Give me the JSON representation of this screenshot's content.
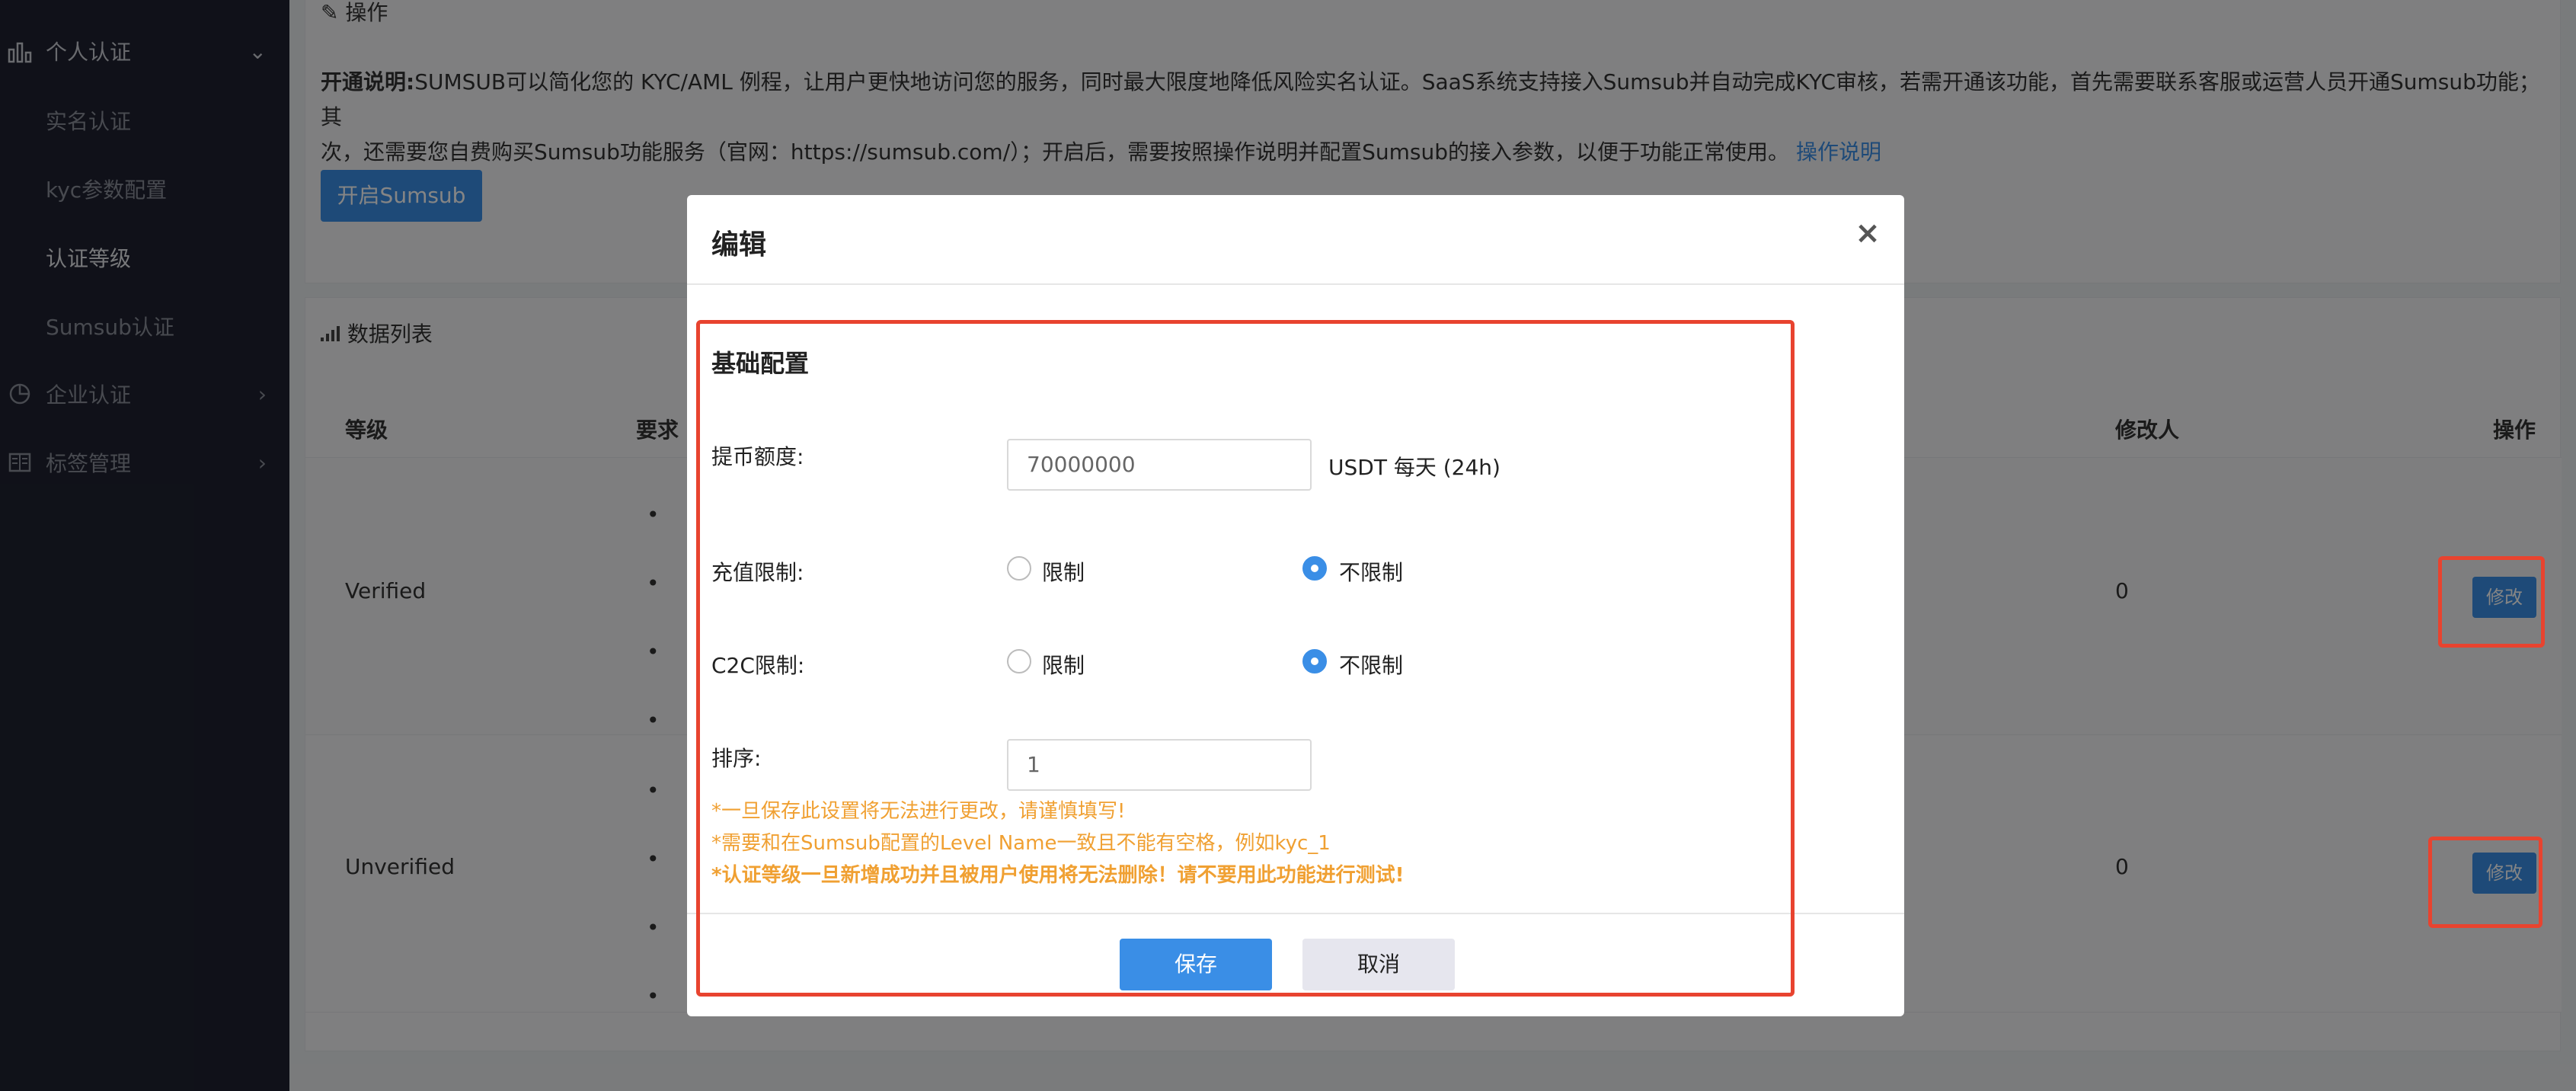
{
  "sidebar": {
    "group_personal": "个人认证",
    "sub_items": [
      "实名认证",
      "kyc参数配置",
      "认证等级",
      "Sumsub认证"
    ],
    "group_enterprise": "企业认证",
    "group_tags": "标签管理"
  },
  "ops_panel": {
    "header": "操作",
    "desc_label": "开通说明:",
    "desc_line1": "SUMSUB可以简化您的 KYC/AML 例程，让用户更快地访问您的服务，同时最大限度地降低风险实名认证。SaaS系统支持接入Sumsub并自动完成KYC审核，若需开通该功能，首先需要联系客服或运营人员开通Sumsub功能；其",
    "desc_line2": "次，还需要您自费购买Sumsub功能服务（官网：https://sumsub.com/）；开启后，需要按照操作说明并配置Sumsub的接入参数，以便于功能正常使用。",
    "desc_link": "操作说明",
    "enable_button": "开启Sumsub"
  },
  "list_panel": {
    "title": "数据列表",
    "columns": {
      "level": "等级",
      "requirement": "要求",
      "modifier": "修改人",
      "action": "操作"
    },
    "rows": [
      {
        "level": "Verified",
        "modifier": "0",
        "action": "修改"
      },
      {
        "level": "Unverified",
        "modifier": "0",
        "action": "修改"
      }
    ]
  },
  "modal": {
    "title": "编辑",
    "close": "×",
    "section_title": "基础配置",
    "withdraw_label": "提币额度:",
    "withdraw_value": "70000000",
    "withdraw_unit": "USDT 每天 (24h)",
    "deposit_label": "充值限制:",
    "c2c_label": "C2C限制:",
    "opt_limit": "限制",
    "opt_unlimited": "不限制",
    "sort_label": "排序:",
    "sort_value": "1",
    "note1": "*一旦保存此设置将无法进行更改，请谨慎填写!",
    "note2": "*需要和在Sumsub配置的Level Name一致且不能有空格，例如kyc_1",
    "note3": "*认证等级一旦新增成功并且被用户使用将无法删除！请不要用此功能进行测试!",
    "save_button": "保存",
    "cancel_button": "取消"
  },
  "colors": {
    "accent": "#3a8ee6",
    "warning": "#f0a032",
    "highlight": "#e8432f"
  }
}
